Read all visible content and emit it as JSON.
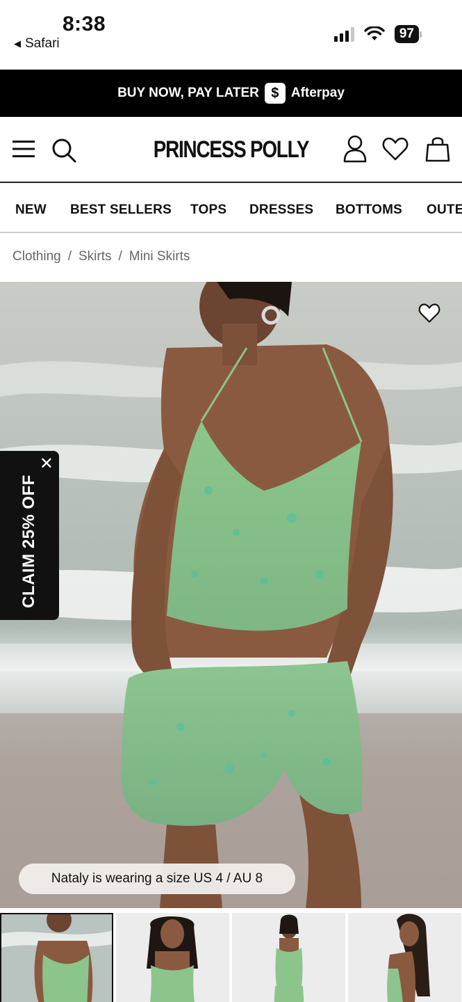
{
  "status": {
    "time": "8:38",
    "back_label": "Safari",
    "battery": "97"
  },
  "promo": {
    "text": "BUY NOW, PAY LATER",
    "badge": "$",
    "provider": "Afterpay"
  },
  "header": {
    "brand": "PRINCESS POLLY",
    "icons": [
      "menu-icon",
      "search-icon",
      "account-icon",
      "wishlist-icon",
      "bag-icon"
    ]
  },
  "categories": [
    "NEW",
    "BEST SELLERS",
    "TOPS",
    "DRESSES",
    "BOTTOMS",
    "OUTE"
  ],
  "breadcrumb": {
    "items": [
      "Clothing",
      "Skirts",
      "Mini Skirts"
    ],
    "separator": "/"
  },
  "hero": {
    "size_note": "Nataly is wearing a size US 4 / AU 8"
  },
  "claim": {
    "text": "CLAIM 25% OFF",
    "close": "✕"
  },
  "colors": {
    "top_green": "#8fc48c",
    "sea": "#b9c3bf",
    "sand": "#b4aaa3",
    "skin": "#8a5a40"
  }
}
